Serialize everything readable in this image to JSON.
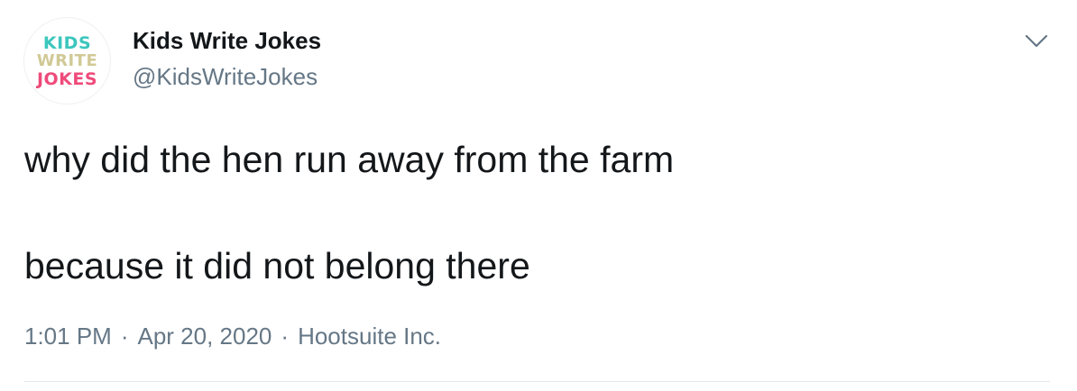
{
  "author": {
    "display_name": "Kids Write Jokes",
    "handle": "@KidsWriteJokes",
    "avatar_logo": {
      "line1": "KIDS",
      "line2": "WRITE",
      "line3": "JOKES",
      "colors": {
        "kids": "#3cc6bd",
        "write": "#d1c996",
        "jokes": "#ef4b7a"
      }
    }
  },
  "menu_icon": "chevron-down-icon",
  "tweet": {
    "line1": "why did the hen run away from the farm",
    "line2": "because it did not belong there"
  },
  "meta": {
    "time": "1:01 PM",
    "separator": "·",
    "date": "Apr 20, 2020",
    "source": "Hootsuite Inc."
  },
  "colors": {
    "text_primary": "#14171a",
    "text_secondary": "#657786",
    "divider": "#e1e8ed"
  }
}
